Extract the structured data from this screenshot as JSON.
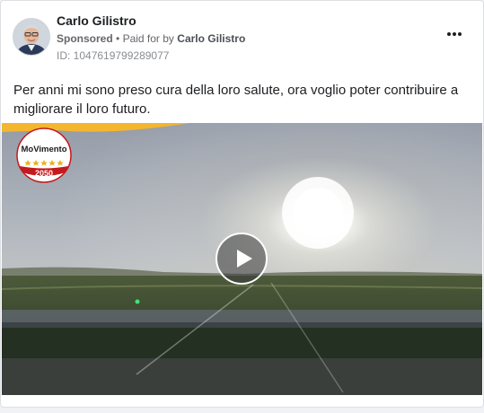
{
  "post": {
    "author": "Carlo Gilistro",
    "sponsored_label": "Sponsored",
    "separator": "•",
    "paid_for_by_label": "Paid for by",
    "paid_for_by_name": "Carlo Gilistro",
    "ad_id_label": "ID: 1047619799289077",
    "body_text": "Per anni mi sono preso cura della loro salute, ora voglio poter contribuire a migliorare il loro futuro.",
    "more_options_icon": "more-horizontal-icon"
  },
  "media": {
    "type": "video",
    "logo_text": "MoVimento",
    "logo_number": "2050",
    "play_icon": "play-icon"
  }
}
